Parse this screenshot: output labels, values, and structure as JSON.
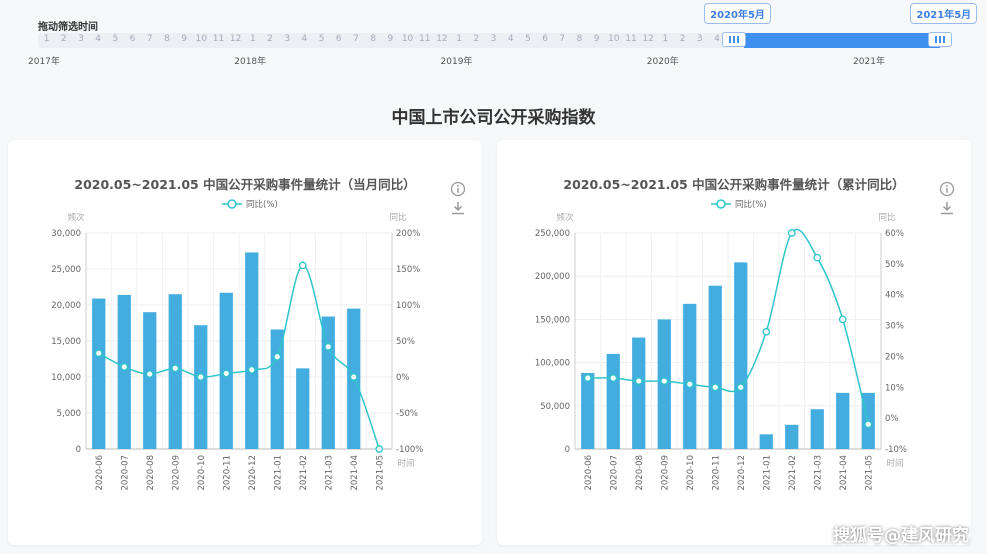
{
  "slider": {
    "title": "拖动筛选时间",
    "months": [
      "1",
      "2",
      "3",
      "4",
      "5",
      "6",
      "7",
      "8",
      "9",
      "10",
      "11",
      "12",
      "1",
      "2",
      "3",
      "4",
      "5",
      "6",
      "7",
      "8",
      "9",
      "10",
      "11",
      "12",
      "1",
      "2",
      "3",
      "4",
      "5",
      "6",
      "7",
      "8",
      "9",
      "10",
      "11",
      "12",
      "1",
      "2",
      "3",
      "4",
      "5",
      "6",
      "7",
      "8",
      "9",
      "10",
      "11",
      "12",
      "1",
      "2",
      "3",
      "4",
      "5"
    ],
    "years": [
      "2017年",
      "2018年",
      "2019年",
      "2020年",
      "2021年"
    ],
    "start_label": "2020年5月",
    "end_label": "2021年5月",
    "start_index": 40,
    "end_index": 52,
    "accent": "#3d8ff0"
  },
  "page_title": "中国上市公司公开采购指数",
  "icons": {
    "info": "info-icon",
    "download": "download-icon"
  },
  "watermark": "搜狐号@建风研究",
  "chart_data": [
    {
      "type": "bar",
      "title": "2020.05~2021.05 中国公开采购事件量统计（当月同比）",
      "legend": [
        "同比(%)"
      ],
      "ylabel": "频次",
      "y2label": "同比",
      "xlabel": "时间",
      "categories": [
        "2020-06",
        "2020-07",
        "2020-08",
        "2020-09",
        "2020-10",
        "2020-11",
        "2020-12",
        "2021-01",
        "2021-02",
        "2021-03",
        "2021-04",
        "2021-05"
      ],
      "bars": [
        20900,
        21400,
        19000,
        21500,
        17200,
        21700,
        27300,
        16600,
        11200,
        18400,
        19500,
        null
      ],
      "line": [
        33,
        14,
        4,
        12,
        0,
        5,
        10,
        28,
        155,
        42,
        0,
        -100
      ],
      "ylim": [
        0,
        30000
      ],
      "yticks": [
        0,
        5000,
        10000,
        15000,
        20000,
        25000,
        30000
      ],
      "ytick_labels": [
        "0",
        "5,000",
        "10,000",
        "15,000",
        "20,000",
        "25,000",
        "30,000"
      ],
      "y2lim": [
        -100,
        200
      ],
      "y2ticks": [
        -100,
        -50,
        0,
        50,
        100,
        150,
        200
      ],
      "y2tick_labels": [
        "-100%",
        "-50%",
        "0%",
        "50%",
        "100%",
        "150%",
        "200%"
      ],
      "bar_color": "#44ade0",
      "line_color": "#2ec5c9"
    },
    {
      "type": "bar",
      "title": "2020.05~2021.05 中国公开采购事件量统计（累计同比）",
      "legend": [
        "同比(%)"
      ],
      "ylabel": "频次",
      "y2label": "同比",
      "xlabel": "时间",
      "categories": [
        "2020-06",
        "2020-07",
        "2020-08",
        "2020-09",
        "2020-10",
        "2020-11",
        "2020-12",
        "2021-01",
        "2021-02",
        "2021-03",
        "2021-04",
        "2021-05"
      ],
      "bars": [
        88000,
        110000,
        129000,
        150000,
        168000,
        189000,
        216000,
        17000,
        28000,
        46000,
        65000,
        65000
      ],
      "line": [
        13,
        13,
        12,
        12,
        11,
        10,
        10,
        28,
        60,
        52,
        32,
        -2
      ],
      "ylim": [
        0,
        250000
      ],
      "yticks": [
        0,
        50000,
        100000,
        150000,
        200000,
        250000
      ],
      "ytick_labels": [
        "0",
        "50,000",
        "100,000",
        "150,000",
        "200,000",
        "250,000"
      ],
      "y2lim": [
        -10,
        60
      ],
      "y2ticks": [
        -10,
        0,
        10,
        20,
        30,
        40,
        50,
        60
      ],
      "y2tick_labels": [
        "-10%",
        "0%",
        "10%",
        "20%",
        "30%",
        "40%",
        "50%",
        "60%"
      ],
      "bar_color": "#44ade0",
      "line_color": "#2ec5c9"
    }
  ]
}
